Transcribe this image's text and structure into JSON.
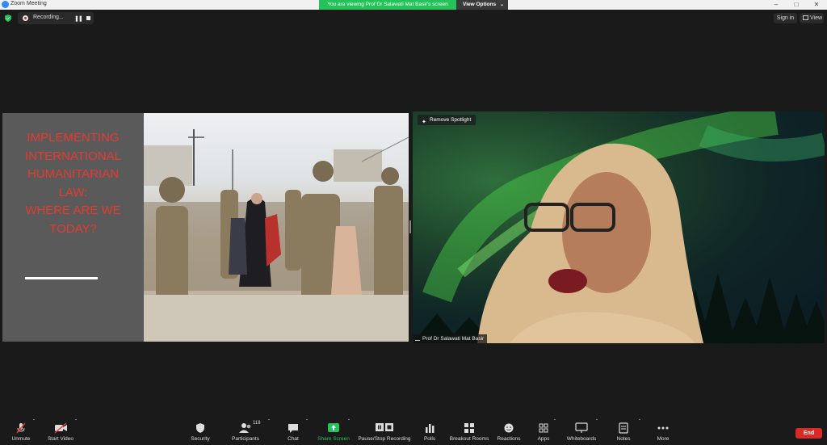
{
  "window": {
    "title": "Zoom Meeting"
  },
  "banner": {
    "text": "You are viewing Prof Dr Salawati Mat Basir's screen",
    "view_options": "View Options"
  },
  "recording": {
    "label": "Recording..."
  },
  "header": {
    "sign_in": "Sign in",
    "view": "View"
  },
  "slide": {
    "title_lines": [
      "IMPLEMENTING",
      "INTERNATIONAL",
      "HUMANITARIAN",
      "LAW:",
      "WHERE ARE WE",
      "TODAY?"
    ]
  },
  "video": {
    "spotlight_label": "Remove Spotlight",
    "participant_name": "Prof Dr Salawati Mat Basir"
  },
  "toolbar": {
    "unmute": "Unmute",
    "start_video": "Start Video",
    "security": "Security",
    "participants": "Participants",
    "participants_count": "118",
    "chat": "Chat",
    "share_screen": "Share Screen",
    "recording": "Pause/Stop Recording",
    "polls": "Polls",
    "breakout": "Breakout Rooms",
    "reactions": "Reactions",
    "apps": "Apps",
    "whiteboards": "Whiteboards",
    "notes": "Notes",
    "more": "More",
    "end": "End"
  },
  "colors": {
    "share_green": "#24c35a",
    "end_red": "#d92a26",
    "slide_title_red": "#e63a2e"
  }
}
